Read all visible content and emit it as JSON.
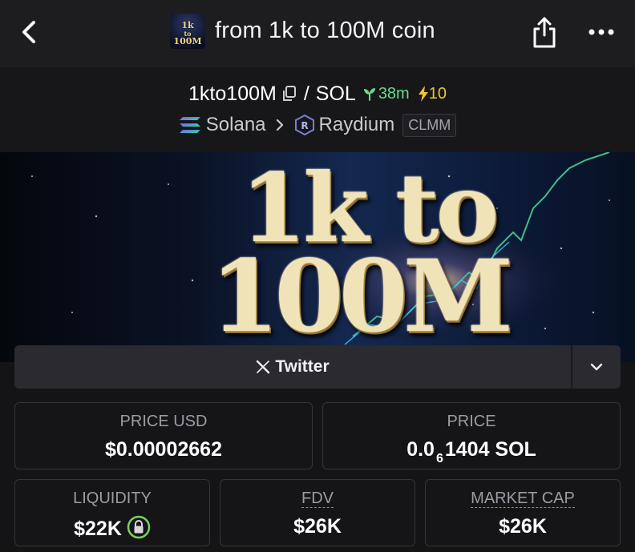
{
  "header": {
    "title": "from 1k to 100M coin",
    "logo_line1": "1k",
    "logo_line2": "to",
    "logo_line3": "100M"
  },
  "pair": {
    "token": "1kto100M",
    "separator": "/",
    "quote": "SOL",
    "age": "38m",
    "boosts": "10",
    "chain": "Solana",
    "dex": "Raydium",
    "pool_type": "CLMM"
  },
  "banner": {
    "line1": "1k to",
    "line2": "100M"
  },
  "social": {
    "twitter_label": "Twitter"
  },
  "stats": {
    "price_usd_label": "PRICE USD",
    "price_usd_value": "$0.00002662",
    "price_label": "PRICE",
    "price_prefix": "0.0",
    "price_zeros": "6",
    "price_suffix": "1404 SOL",
    "liquidity_label": "LIQUIDITY",
    "liquidity_value": "$22K",
    "fdv_label": "FDV",
    "fdv_value": "$26K",
    "mcap_label": "MARKET CAP",
    "mcap_value": "$26K"
  },
  "colors": {
    "age_green": "#6cd98a",
    "boost_yellow": "#f2c230",
    "lock_green": "#7ccf5a",
    "background": "#141416"
  },
  "icons": {
    "back": "chevron-left-icon",
    "share": "share-icon",
    "more": "more-horizontal-icon",
    "copy": "copy-icon",
    "age": "seedling-icon",
    "boost": "lightning-icon",
    "chain": "solana-icon",
    "dex": "raydium-icon",
    "twitter": "x-icon",
    "social_more": "chevron-down-icon",
    "liquidity_lock": "lock-icon"
  }
}
